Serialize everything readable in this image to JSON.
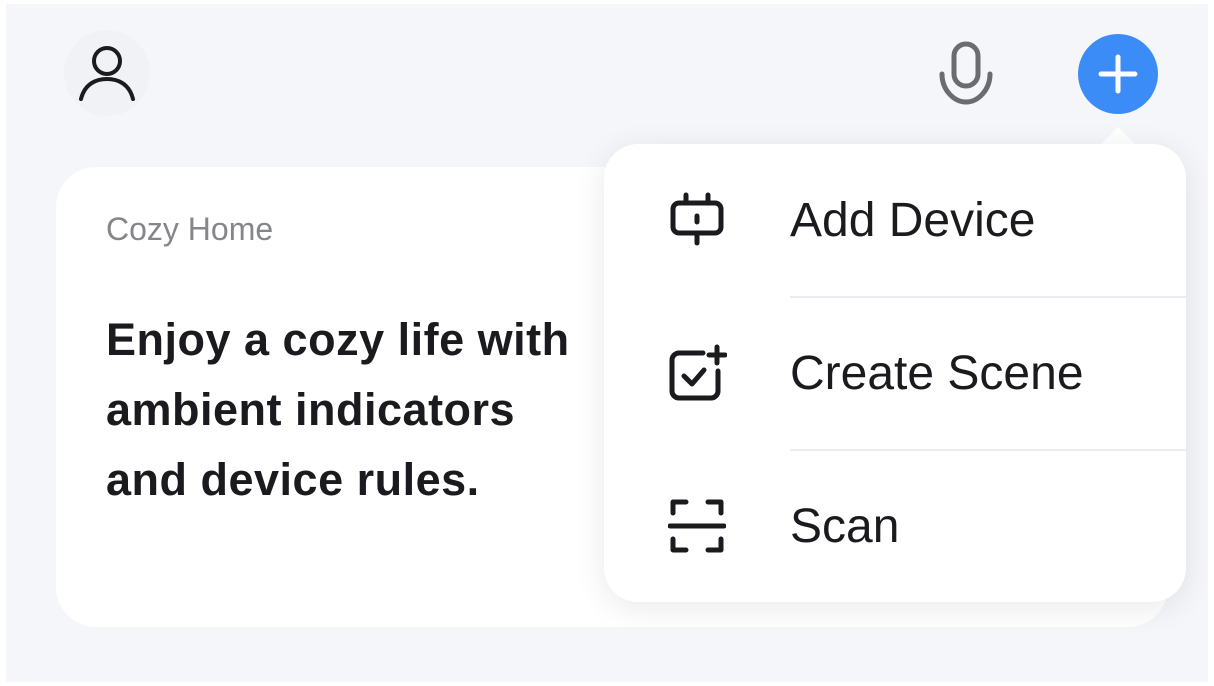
{
  "header": {
    "avatar_icon": "user-profile-icon",
    "mic_icon": "microphone-icon",
    "add_icon": "plus-icon",
    "accent_color": "#3c8cf8"
  },
  "card": {
    "title": "Cozy Home",
    "description_lines": [
      "Enjoy a cozy life with",
      "ambient indicators",
      "and device rules."
    ]
  },
  "menu": {
    "items": [
      {
        "label": "Add Device",
        "icon": "add-device-icon"
      },
      {
        "label": "Create Scene",
        "icon": "create-scene-icon"
      },
      {
        "label": "Scan",
        "icon": "scan-icon"
      }
    ]
  }
}
